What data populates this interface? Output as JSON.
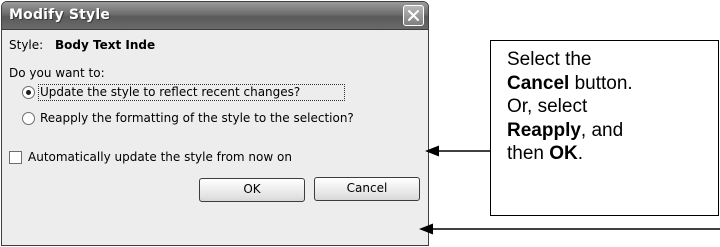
{
  "dialog": {
    "title": "Modify Style",
    "style_label": "Style:",
    "style_value": "Body Text Inde",
    "question": "Do you want to:",
    "options": [
      {
        "label": "Update the style to reflect recent changes?",
        "selected": true
      },
      {
        "label": "Reapply the formatting of the style to the selection?",
        "selected": false
      }
    ],
    "auto_update": {
      "label": "Automatically update the style from now on",
      "checked": false
    },
    "ok_label": "OK",
    "cancel_label": "Cancel"
  },
  "callout": {
    "line1": "Select the",
    "line2_bold": "Cancel",
    "line2_rest": " button.",
    "line3": "Or, select",
    "line4_bold": "Reapply",
    "line4_rest": ", and",
    "line5_pre": "then ",
    "line5_bold": "OK",
    "line5_end": "."
  },
  "icons": {
    "close": "close-icon",
    "arrow": "arrow-left-icon"
  },
  "colors": {
    "titlebar": "#6d6d6d",
    "dialog_bg": "#ededed"
  }
}
